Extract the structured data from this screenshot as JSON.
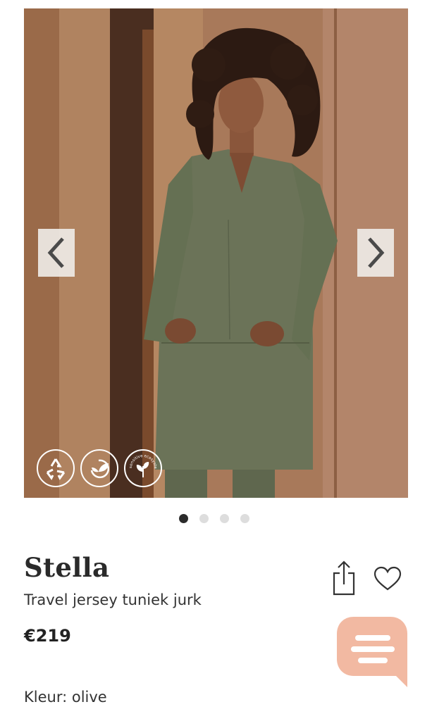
{
  "gallery": {
    "photo_alt": "Stella olive tuniek jurk",
    "prev_icon": "chevron-left-icon",
    "next_icon": "chevron-right-icon",
    "badges": [
      {
        "icon": "recycle-icon"
      },
      {
        "icon": "leaf-circle-icon"
      },
      {
        "icon": "sensitive-ecosystem-icon",
        "text": "sensitive ecosystem"
      }
    ],
    "slide_count": 4,
    "active_slide": 1
  },
  "product": {
    "name": "Stella",
    "subtitle": "Travel jersey tuniek jurk",
    "price": "€219",
    "color_line": "Kleur: olive"
  },
  "actions": {
    "share_icon": "share-icon",
    "favorite_icon": "heart-icon",
    "chat_icon": "chat-bubble-icon"
  },
  "colors": {
    "dress": "#6b7358",
    "wall": "#a87a58",
    "chat_bubble": "#f2b9a2",
    "active_dot": "#2b2b2b",
    "inactive_dot": "#dddddd"
  }
}
